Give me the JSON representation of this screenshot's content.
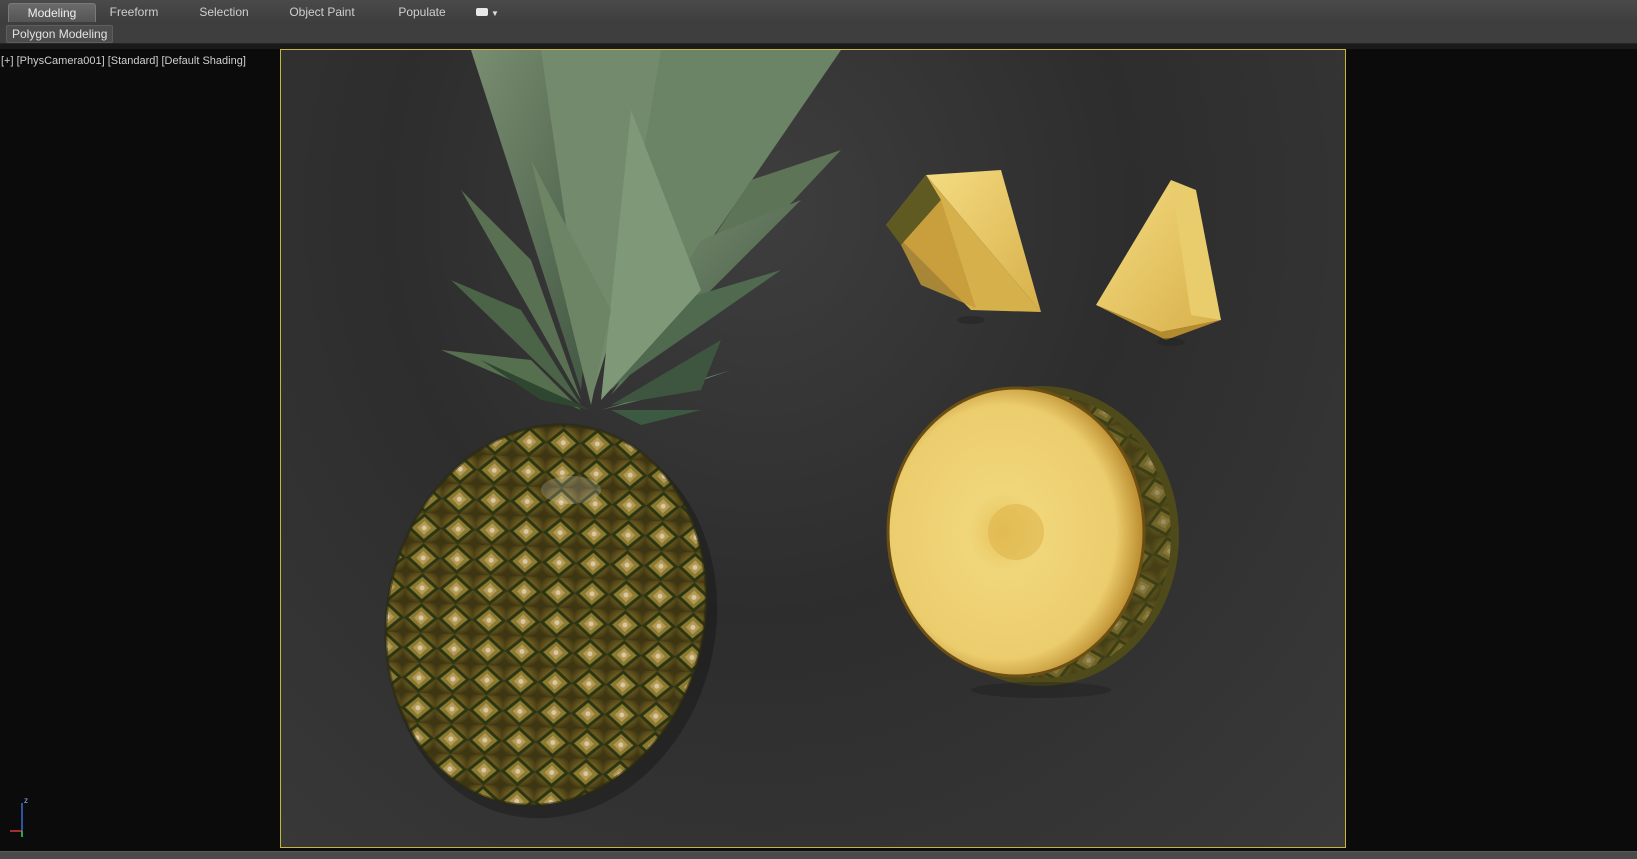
{
  "ribbon": {
    "tabs": [
      {
        "label": "Modeling",
        "active": true
      },
      {
        "label": "Freeform",
        "active": false
      },
      {
        "label": "Selection",
        "active": false
      },
      {
        "label": "Object Paint",
        "active": false
      },
      {
        "label": "Populate",
        "active": false
      }
    ],
    "overflow_icon": "ribbon-options-icon",
    "panel_label": "Polygon Modeling"
  },
  "viewport": {
    "label": "[+] [PhysCamera001] [Standard] [Default Shading]",
    "axis_labels": {
      "z": "z"
    },
    "frame_color": "#c9b53a",
    "objects": [
      "pineapple",
      "pineapple-wedge-left",
      "pineapple-wedge-right",
      "pineapple-slice"
    ]
  },
  "colors": {
    "ribbon_bg": "#454545",
    "viewport_bg": "#0b0b0b",
    "scene_bg": "#333333",
    "safe_frame": "#c9b53a"
  }
}
